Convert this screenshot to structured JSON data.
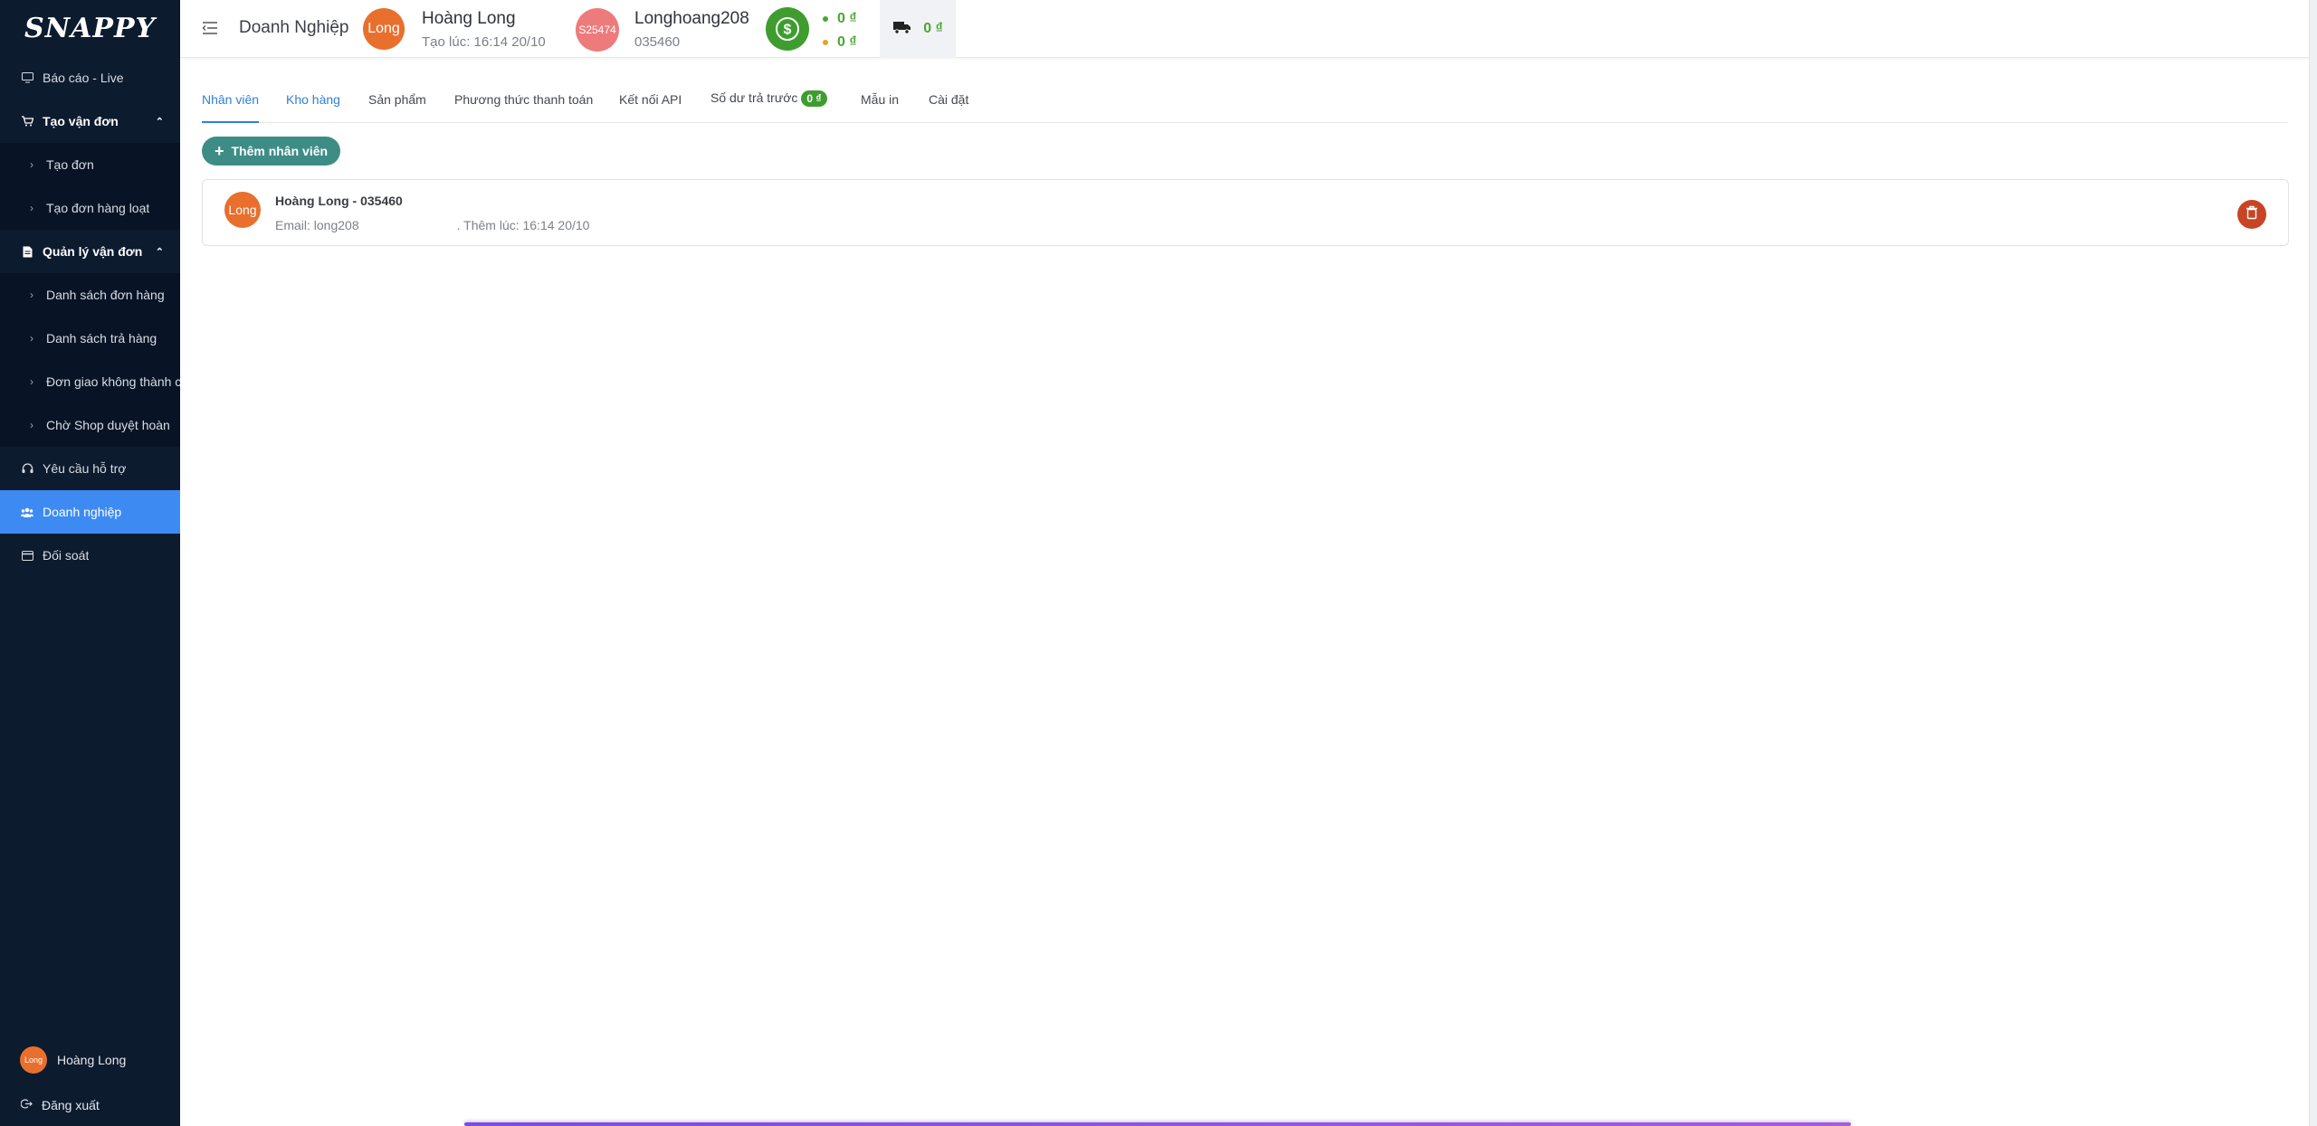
{
  "sidebar": {
    "brand": "SNAPPY",
    "items": [
      {
        "label": "Báo cáo - Live"
      },
      {
        "label": "Tạo vận đơn"
      },
      {
        "label": "Tạo đơn"
      },
      {
        "label": "Tạo đơn hàng loạt"
      },
      {
        "label": "Quản lý vận đơn"
      },
      {
        "label": "Danh sách đơn hàng"
      },
      {
        "label": "Danh sách trả hàng"
      },
      {
        "label": "Đơn giao không thành công"
      },
      {
        "label": "Chờ Shop duyệt hoàn"
      },
      {
        "label": "Yêu cầu hỗ trợ"
      },
      {
        "label": "Doanh nghiệp"
      },
      {
        "label": "Đối soát"
      }
    ],
    "user_avatar": "Long",
    "user_name": "Hoàng Long",
    "logout": "Đăng xuất"
  },
  "header": {
    "title": "Doanh Nghiệp",
    "user_avatar": "Long",
    "user_name": "Hoàng Long",
    "user_created": "Tạo lúc: 16:14 20/10",
    "shop_avatar": "S25474",
    "shop_name": "Longhoang208",
    "shop_phone": "035460",
    "balance_1": "0 ₫",
    "balance_2": "0 ₫",
    "cod_value": "0 ₫"
  },
  "tabs": {
    "employees": "Nhân viên",
    "warehouse": "Kho hàng",
    "products": "Sản phẩm",
    "payment": "Phương thức thanh toán",
    "api": "Kết nối API",
    "prepaid": "Số dư trả trước",
    "prepaid_badge": "0 ₫",
    "print": "Mẫu in",
    "settings": "Cài đặt"
  },
  "content": {
    "add_button": "Thêm nhân viên",
    "employee": {
      "avatar": "Long",
      "name": "Hoàng Long - 035460",
      "email_meta": "Email: long208",
      "added": ". Thêm lúc: 16:14 20/10"
    }
  },
  "colors": {
    "sidebar_bg": "#0d1b2f",
    "active_blue": "#3d8bf2",
    "accent_orange": "#e96f2d",
    "money_green": "#3e9d2e",
    "teal_button": "#3d8d86",
    "delete_red": "#c74525"
  }
}
